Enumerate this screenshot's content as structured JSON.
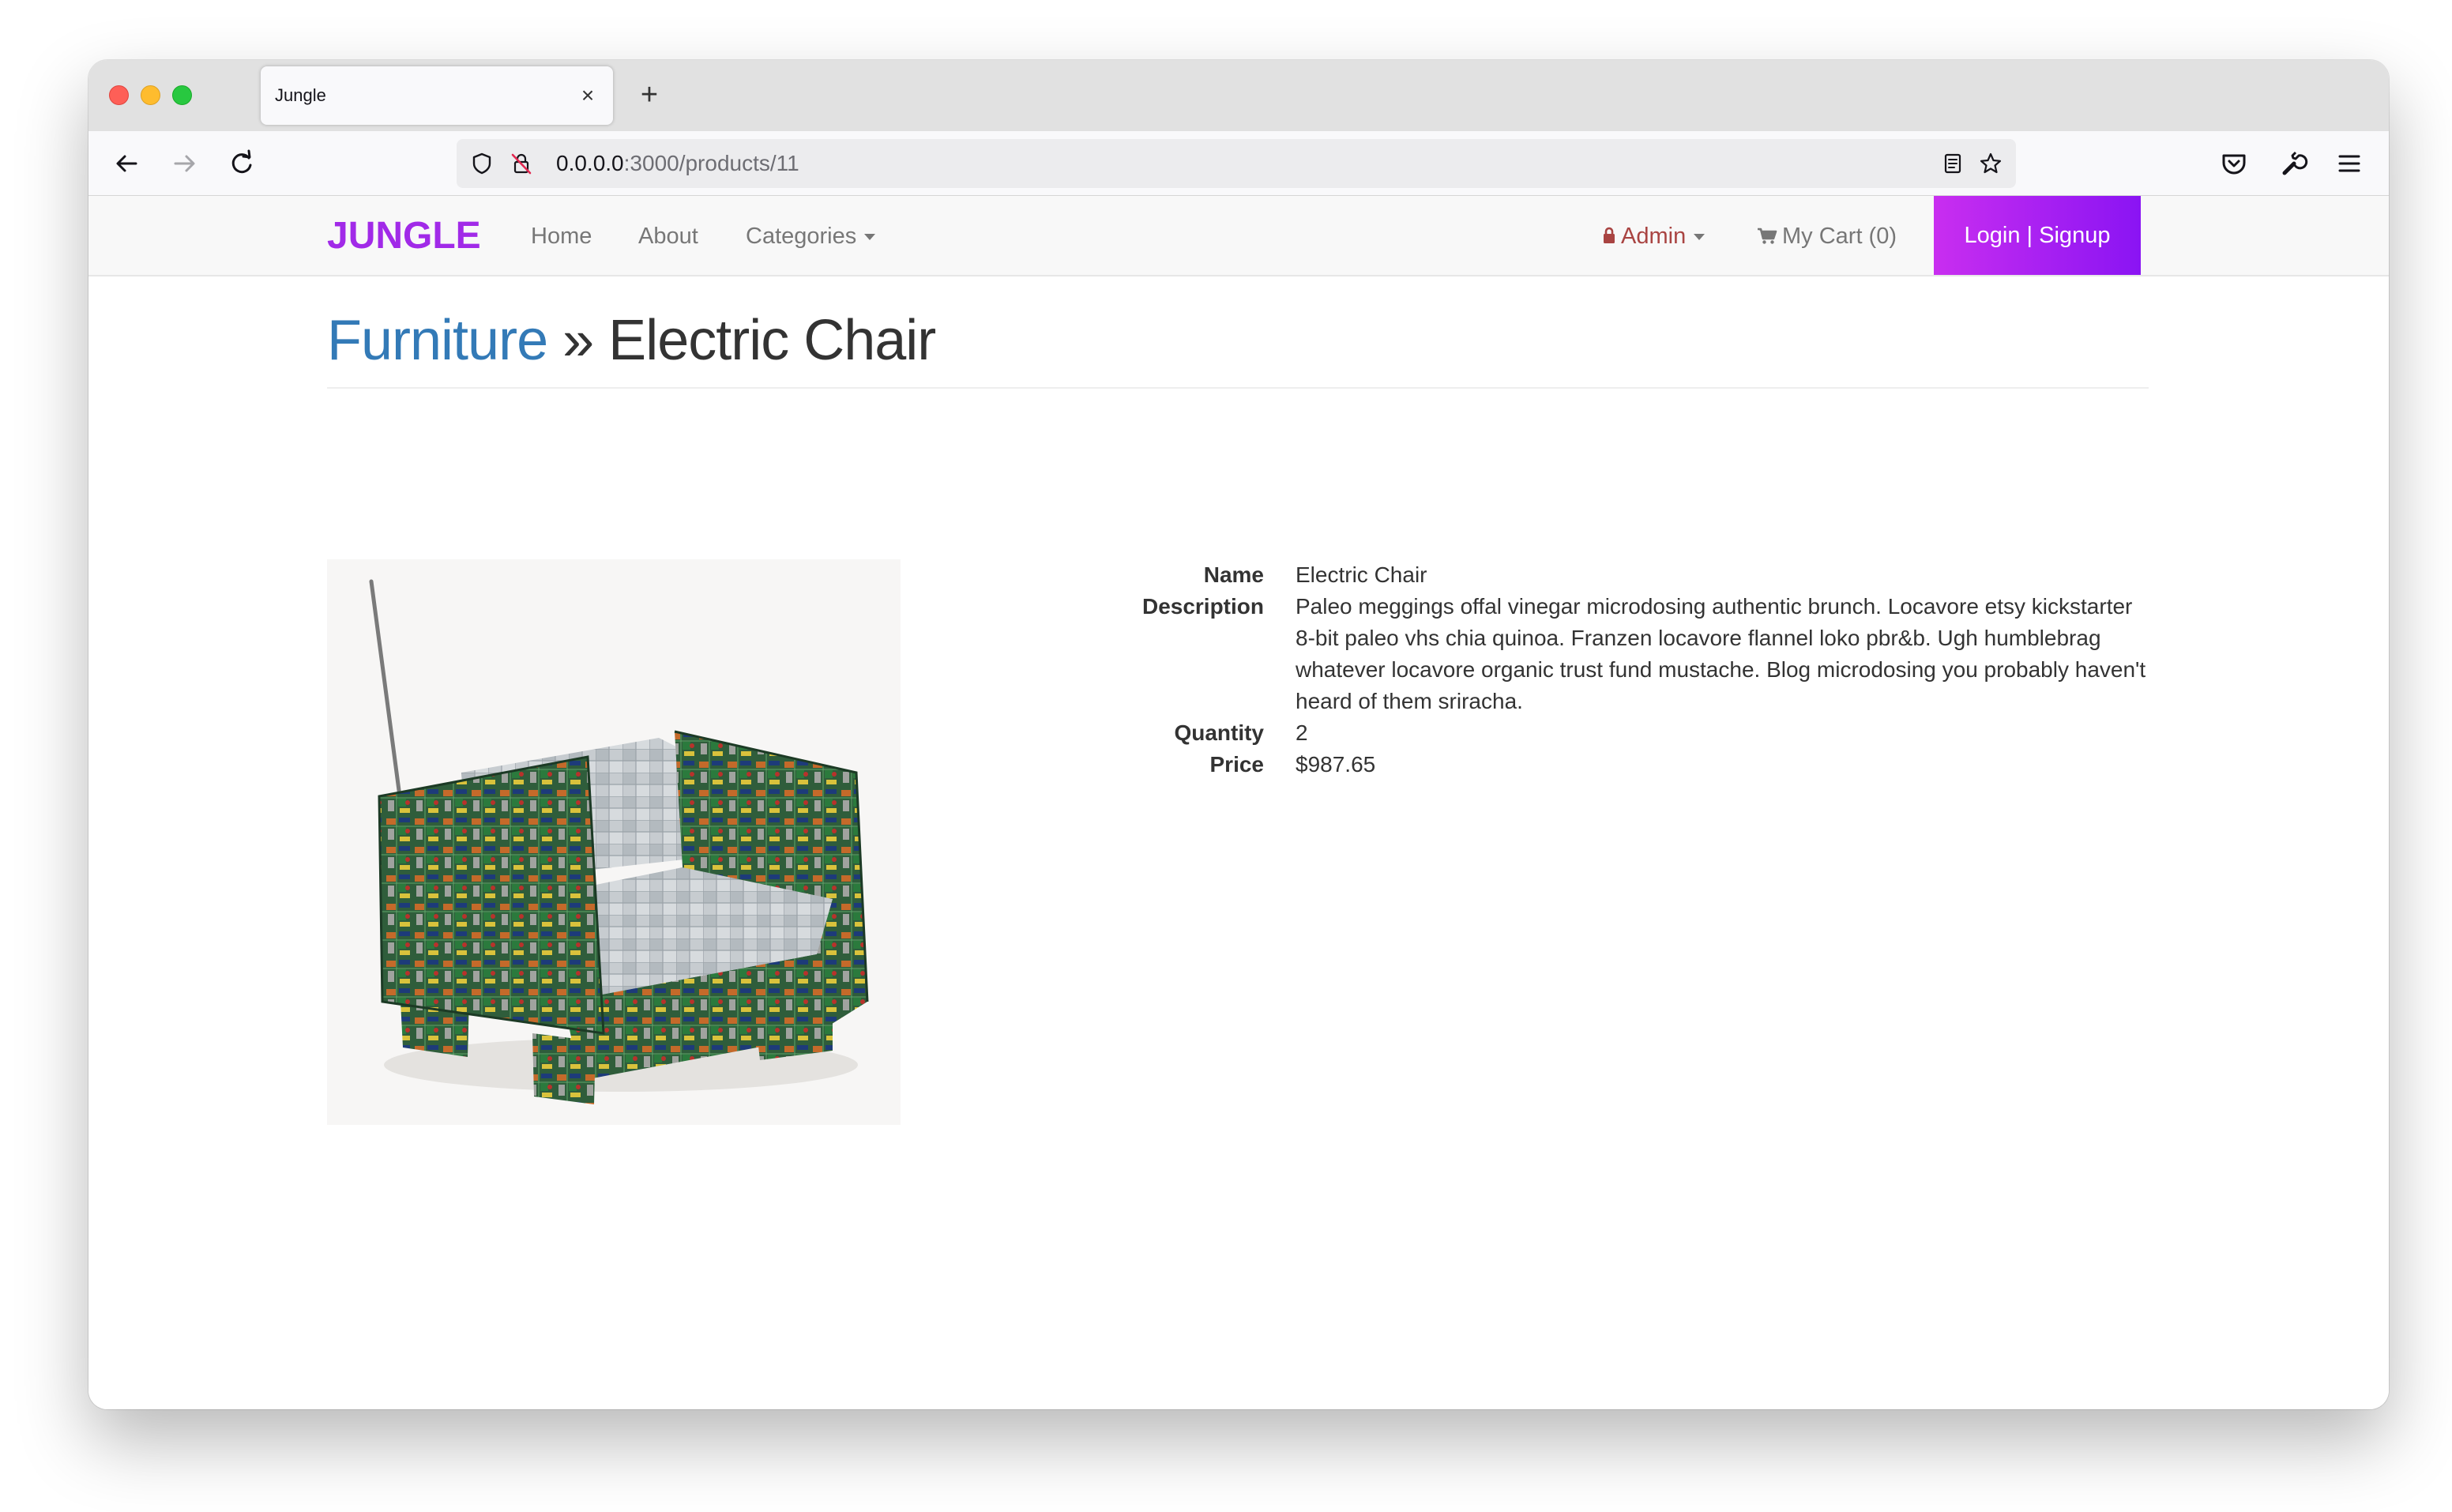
{
  "browser": {
    "tab_title": "Jungle",
    "tab_close_glyph": "×",
    "new_tab_glyph": "+",
    "url_host": "0.0.0.0",
    "url_path": ":3000/products/11",
    "icons": [
      "back-arrow-icon",
      "forward-arrow-icon",
      "reload-icon",
      "shield-icon",
      "insecure-lock-icon",
      "reader-view-icon",
      "bookmark-star-icon",
      "pocket-icon",
      "wrench-icon",
      "hamburger-menu-icon"
    ]
  },
  "site_nav": {
    "brand": "JUNGLE",
    "links": {
      "home": "Home",
      "about": "About",
      "categories": "Categories"
    },
    "admin": "Admin",
    "cart": "My Cart (0)",
    "login": "Login | Signup",
    "brand_color": "#a12ae8",
    "login_gradient": [
      "#c92ef0",
      "#8a14f3"
    ]
  },
  "page": {
    "breadcrumb_category": "Furniture",
    "breadcrumb_separator": " » ",
    "title": "Electric Chair",
    "link_color": "#337ab7"
  },
  "product": {
    "labels": {
      "name": "Name",
      "description": "Description",
      "quantity": "Quantity",
      "price": "Price"
    },
    "name": "Electric Chair",
    "description": "Paleo meggings offal vinegar microdosing authentic brunch. Locavore etsy kickstarter 8-bit paleo vhs chia quinoa. Franzen locavore flannel loko pbr&b. Ugh humblebrag whatever locavore organic trust fund mustache. Blog microdosing you probably haven't heard of them sriracha.",
    "quantity": "2",
    "price": "$987.65",
    "image_alt": "Electric Chair"
  }
}
